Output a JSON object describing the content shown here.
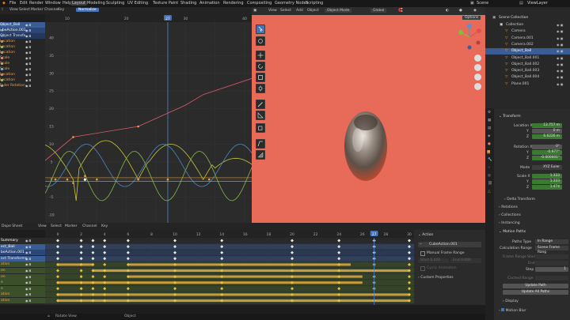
{
  "menu": {
    "items": [
      "File",
      "Edit",
      "Render",
      "Window",
      "Help"
    ],
    "workspace_tabs": [
      "Layout",
      "Modeling",
      "Sculpting",
      "UV Editing",
      "Texture Paint",
      "Shading",
      "Animation",
      "Rendering",
      "Compositing",
      "Geometry Nodes",
      "Scripting"
    ],
    "active_tab": "Layout",
    "scene_label": "Scene",
    "view_layer_label": "ViewLayer"
  },
  "graph_editor": {
    "header_items": [
      "View",
      "Select",
      "Marker",
      "Channel",
      "Key"
    ],
    "normalize_label": "Normalize",
    "frame_ticks": [
      "10",
      "20",
      "27",
      "30",
      "40"
    ],
    "current_frame": "27",
    "value_ticks": [
      "40",
      "35",
      "30",
      "25",
      "20",
      "15",
      "10",
      "5",
      "0",
      "-5",
      "-10"
    ],
    "channels": [
      {
        "label": "Object_Ball",
        "color": "#4772b3",
        "row_bg": "#3b5d95",
        "text": "#ffffff"
      },
      {
        "label": "ubeAction.001",
        "color": "#4772b3",
        "row_bg": "#2c4677",
        "text": "#ffffff"
      },
      {
        "label": "Object Transfo",
        "color": "#4772b3",
        "row_bg": "#24385d",
        "text": "#e8e8e8"
      },
      {
        "label": "Location",
        "color": "#e06c6c",
        "row_bg": "#262626",
        "text": "#e0a15d"
      },
      {
        "label": "Location",
        "color": "#7fbf3f",
        "row_bg": "#262626",
        "text": "#e0a15d"
      },
      {
        "label": "Location",
        "color": "#5aa0e0",
        "row_bg": "#262626",
        "text": "#e0a15d"
      },
      {
        "label": "Scale",
        "color": "#e06c6c",
        "row_bg": "#262626",
        "text": "#e0a15d"
      },
      {
        "label": "Scale",
        "color": "#7fbf3f",
        "row_bg": "#262626",
        "text": "#e0a15d"
      },
      {
        "label": "Scale",
        "color": "#5aa0e0",
        "row_bg": "#262626",
        "text": "#e0a15d"
      },
      {
        "label": "Location",
        "color": "#e06c6c",
        "row_bg": "#262626",
        "text": "#e0a15d"
      },
      {
        "label": "Location",
        "color": "#7fbf3f",
        "row_bg": "#262626",
        "text": "#e0a15d"
      },
      {
        "label": "Euler Rotation",
        "color": "#5aa0e0",
        "row_bg": "#262626",
        "text": "#e0a15d"
      }
    ]
  },
  "viewport": {
    "header_items": [
      "View",
      "Select",
      "Add",
      "Object"
    ],
    "mode_label": "Object Mode",
    "pivot_label": "Global",
    "options_label": "Options"
  },
  "outliner": {
    "title": "Scene Collection",
    "items": [
      {
        "label": "Collection",
        "selected": false,
        "indent": 0
      },
      {
        "label": "Camera",
        "selected": false,
        "indent": 1
      },
      {
        "label": "Camera.001",
        "selected": false,
        "indent": 1
      },
      {
        "label": "Camera.002",
        "selected": false,
        "indent": 1
      },
      {
        "label": "Object_Ball",
        "selected": true,
        "indent": 1
      },
      {
        "label": "Object_Ball.001",
        "selected": false,
        "indent": 1
      },
      {
        "label": "Object_Ball.002",
        "selected": false,
        "indent": 1
      },
      {
        "label": "Object_Ball.003",
        "selected": false,
        "indent": 1
      },
      {
        "label": "Object_Ball.004",
        "selected": false,
        "indent": 1
      },
      {
        "label": "Plane.001",
        "selected": false,
        "indent": 1
      }
    ]
  },
  "properties": {
    "transform_label": "Transform",
    "location_label": "Location X",
    "location": [
      "12.757 m",
      "0 m",
      "6.6226 m"
    ],
    "rotation_label": "Rotation X",
    "rotation": [
      "0°",
      "-0.977°",
      "-0.000001°"
    ],
    "mode_label": "Mode",
    "mode_value": "XYZ Euler",
    "scale_label": "Scale X",
    "scale": [
      "1.333",
      "1.333",
      "1.474"
    ],
    "y_label": "Y",
    "z_label": "Z",
    "sections": [
      "Delta Transform",
      "Relations",
      "Collections",
      "Instancing",
      "Motion Paths"
    ],
    "paths_type_label": "Paths Type",
    "paths_type_value": "In Range",
    "calc_range_label": "Calculation Range",
    "calc_range_value": "Scene Frame Rang",
    "frame_range_start_label": "Frame Range Start",
    "end_label": "End",
    "step_label": "Step",
    "step_value": "1",
    "cache_range_label": "Cached Range",
    "update_path_label": "Update Path",
    "update_all_label": "Update All Paths",
    "display_label": "Display",
    "motion_blur_label": "Motion Blur"
  },
  "dope_sheet": {
    "editor_label": "Dope Sheet",
    "header_items": [
      "View",
      "Select",
      "Marker",
      "Channel",
      "Key"
    ],
    "frame_ticks": [
      "0",
      "2",
      "4",
      "6",
      "8",
      "10",
      "12",
      "14",
      "16",
      "18",
      "20",
      "22",
      "24",
      "26",
      "27",
      "28",
      "30"
    ],
    "current_frame": "27",
    "channels": [
      {
        "label": "Summary",
        "row_bg": "#2a2a2a",
        "text": "#ffffff"
      },
      {
        "label": "ect_Ball",
        "row_bg": "#3b5d95",
        "text": "#ffffff"
      },
      {
        "label": "beAction.001",
        "row_bg": "#2c4677",
        "text": "#ffffff"
      },
      {
        "label": "ect Transforms",
        "row_bg": "#3b5d95",
        "text": "#e8e8e8"
      },
      {
        "label": "ation",
        "row_bg": "#3a4f2a",
        "text": "#e0a15d"
      },
      {
        "label": "on",
        "row_bg": "#3a4f2a",
        "text": "#e0a15d"
      },
      {
        "label": "on",
        "row_bg": "#3a4f2a",
        "text": "#e0a15d"
      },
      {
        "label": "e",
        "row_bg": "#3a4f2a",
        "text": "#e0a15d"
      },
      {
        "label": "e",
        "row_bg": "#3a4f2a",
        "text": "#e0a15d"
      },
      {
        "label": "ation",
        "row_bg": "#3a4f2a",
        "text": "#e0a15d"
      },
      {
        "label": "ation",
        "row_bg": "#3a4f2a",
        "text": "#e0a15d"
      }
    ]
  },
  "action_panel": {
    "title": "Action",
    "action_name": "CubeAction.001",
    "manual_range_label": "Manual Frame Range",
    "start_label": "Start",
    "start_value": "0.000",
    "end_label": "End",
    "end_value": "0.000",
    "cyclic_label": "Cyclic Animation",
    "custom_props_label": "Custom Properties"
  },
  "status_bar": {
    "left": "Rotate View",
    "right": "Object"
  }
}
